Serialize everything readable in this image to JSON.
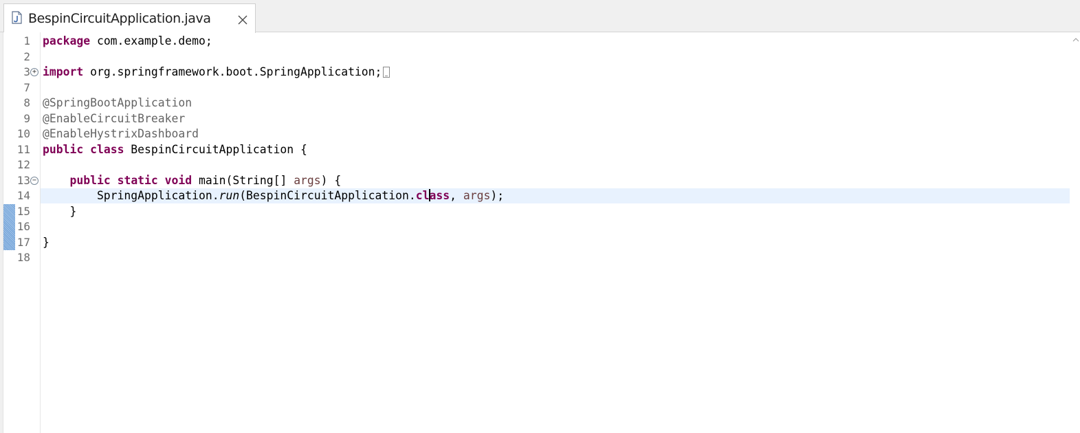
{
  "tab": {
    "title": "BespinCircuitApplication.java",
    "file_icon": "java-file-icon",
    "close_icon": "close-icon"
  },
  "colors": {
    "keyword": "#7f0055",
    "annotation": "#646464",
    "parameter": "#6a3e3e",
    "current_line": "#e8f2fe"
  },
  "editor": {
    "current_line_number": "14",
    "lines": [
      {
        "n": "1",
        "tokens": [
          {
            "t": "package",
            "c": "kw"
          },
          {
            "t": " com.example.demo;"
          }
        ]
      },
      {
        "n": "2",
        "tokens": []
      },
      {
        "n": "3",
        "fold": "expand",
        "tokens": [
          {
            "t": "import",
            "c": "kw"
          },
          {
            "t": " org.springframework.boot.SpringApplication;"
          }
        ],
        "collapsed": true
      },
      {
        "n": "7",
        "tokens": []
      },
      {
        "n": "8",
        "tokens": [
          {
            "t": "@SpringBootApplication",
            "c": "ann"
          }
        ]
      },
      {
        "n": "9",
        "tokens": [
          {
            "t": "@EnableCircuitBreaker",
            "c": "ann"
          }
        ]
      },
      {
        "n": "10",
        "tokens": [
          {
            "t": "@EnableHystrixDashboard",
            "c": "ann"
          }
        ]
      },
      {
        "n": "11",
        "tokens": [
          {
            "t": "public",
            "c": "kw"
          },
          {
            "t": " "
          },
          {
            "t": "class",
            "c": "kw"
          },
          {
            "t": " BespinCircuitApplication {"
          }
        ]
      },
      {
        "n": "12",
        "tokens": []
      },
      {
        "n": "13",
        "fold": "collapse",
        "tokens": [
          {
            "t": "    "
          },
          {
            "t": "public",
            "c": "kw"
          },
          {
            "t": " "
          },
          {
            "t": "static",
            "c": "kw"
          },
          {
            "t": " "
          },
          {
            "t": "void",
            "c": "kw"
          },
          {
            "t": " main(String[] "
          },
          {
            "t": "args",
            "c": "param"
          },
          {
            "t": ") {"
          }
        ]
      },
      {
        "n": "14",
        "current": true,
        "tokens": [
          {
            "t": "        SpringApplication."
          },
          {
            "t": "run",
            "c": "ital"
          },
          {
            "t": "(BespinCircuitApplication."
          },
          {
            "t": "cl",
            "c": "kw"
          },
          {
            "caret": true
          },
          {
            "t": "ass",
            "c": "kw"
          },
          {
            "t": ", "
          },
          {
            "t": "args",
            "c": "param"
          },
          {
            "t": ");"
          }
        ]
      },
      {
        "n": "15",
        "tokens": [
          {
            "t": "    }"
          }
        ]
      },
      {
        "n": "16",
        "tokens": []
      },
      {
        "n": "17",
        "tokens": [
          {
            "t": "}"
          }
        ]
      },
      {
        "n": "18",
        "tokens": []
      }
    ]
  }
}
